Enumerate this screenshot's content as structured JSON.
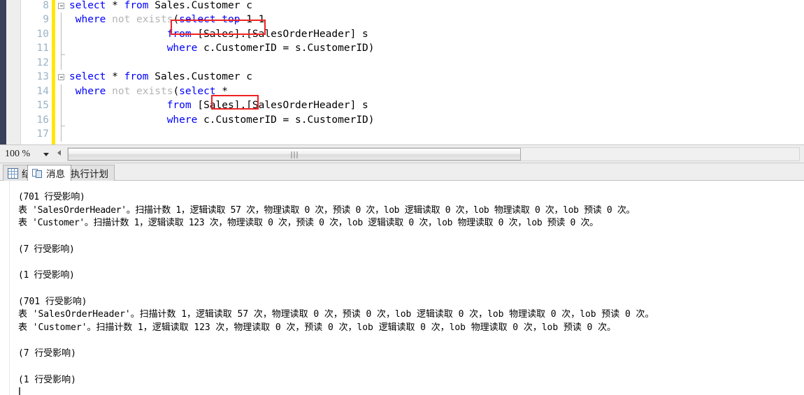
{
  "app": {
    "name": "SQL Server Management Studio",
    "pane_kind": "query-editor-with-messages"
  },
  "editor": {
    "gutter_change_color": "#ffe800",
    "selection_margin_color": "#394059",
    "keyword_color": "#0000ff",
    "comment_gray_color": "#b4b4b4",
    "lines": [
      {
        "number": "8",
        "outline": "collapse-box",
        "segments": [
          {
            "t": "select",
            "c": "kw"
          },
          {
            "t": " * ",
            "c": "blk"
          },
          {
            "t": "from",
            "c": "kw"
          },
          {
            "t": " Sales.Customer c",
            "c": "blk"
          }
        ]
      },
      {
        "number": "9",
        "outline": "vline",
        "segments": [
          {
            "t": " ",
            "c": "blk"
          },
          {
            "t": "where",
            "c": "kw"
          },
          {
            "t": " ",
            "c": "blk"
          },
          {
            "t": "not exists",
            "c": "gr"
          },
          {
            "t": "(",
            "c": "blk"
          },
          {
            "t": "select",
            "c": "kw"
          },
          {
            "t": " ",
            "c": "blk"
          },
          {
            "t": "top",
            "c": "kw"
          },
          {
            "t": " 1 1",
            "c": "blk"
          }
        ]
      },
      {
        "number": "10",
        "outline": "vline",
        "segments": [
          {
            "t": "                ",
            "c": "blk"
          },
          {
            "t": "from",
            "c": "kw"
          },
          {
            "t": " [Sales].[SalesOrderHeader] s",
            "c": "blk"
          }
        ]
      },
      {
        "number": "11",
        "outline": "vline-foot",
        "segments": [
          {
            "t": "                ",
            "c": "blk"
          },
          {
            "t": "where",
            "c": "kw"
          },
          {
            "t": " c.CustomerID = s.CustomerID)",
            "c": "blk"
          }
        ]
      },
      {
        "number": "12",
        "outline": "vline",
        "segments": [
          {
            "t": "",
            "c": "blk"
          }
        ]
      },
      {
        "number": "13",
        "outline": "collapse-box",
        "segments": [
          {
            "t": "select",
            "c": "kw"
          },
          {
            "t": " * ",
            "c": "blk"
          },
          {
            "t": "from",
            "c": "kw"
          },
          {
            "t": " Sales.Customer c",
            "c": "blk"
          }
        ]
      },
      {
        "number": "14",
        "outline": "vline",
        "segments": [
          {
            "t": " ",
            "c": "blk"
          },
          {
            "t": "where",
            "c": "kw"
          },
          {
            "t": " ",
            "c": "blk"
          },
          {
            "t": "not exists",
            "c": "gr"
          },
          {
            "t": "(",
            "c": "blk"
          },
          {
            "t": "select",
            "c": "kw"
          },
          {
            "t": " * ",
            "c": "blk"
          }
        ]
      },
      {
        "number": "15",
        "outline": "vline",
        "segments": [
          {
            "t": "                ",
            "c": "blk"
          },
          {
            "t": "from",
            "c": "kw"
          },
          {
            "t": " [Sales].[SalesOrderHeader] s",
            "c": "blk"
          }
        ]
      },
      {
        "number": "16",
        "outline": "vline-foot",
        "segments": [
          {
            "t": "                ",
            "c": "blk"
          },
          {
            "t": "where",
            "c": "kw"
          },
          {
            "t": " c.CustomerID = s.CustomerID)",
            "c": "blk"
          }
        ]
      },
      {
        "number": "17",
        "outline": "vline",
        "segments": [
          {
            "t": "",
            "c": "blk"
          }
        ]
      }
    ],
    "annotations": [
      {
        "label": "select top 1 1",
        "color": "#ee2222"
      },
      {
        "label": "*",
        "color": "#ee2222"
      }
    ]
  },
  "toolbar": {
    "zoom_value": "100 %",
    "zoom_caret_icon": "chevron-down-icon",
    "hscroll_left_icon": "arrow-left-icon"
  },
  "result_tabs": [
    {
      "label": "结果",
      "icon": "grid-icon",
      "active": false
    },
    {
      "label": "消息",
      "icon": "document-icon",
      "active": true
    },
    {
      "label": "执行计划",
      "icon": "execution-plan-icon",
      "active": false
    }
  ],
  "messages": {
    "lines": [
      {
        "text": "(701 行受影响)",
        "spacing": "tight"
      },
      {
        "text": "表 'SalesOrderHeader'。扫描计数 1，逻辑读取 57 次，物理读取 0 次，预读 0 次，lob 逻辑读取 0 次，lob 物理读取 0 次，lob 预读 0 次。",
        "spacing": "tight"
      },
      {
        "text": "表 'Customer'。扫描计数 1，逻辑读取 123 次，物理读取 0 次，预读 0 次，lob 逻辑读取 0 次，lob 物理读取 0 次，lob 预读 0 次。",
        "spacing": "tight"
      },
      {
        "text": "",
        "spacing": "tight"
      },
      {
        "text": "(7 行受影响)",
        "spacing": "tight"
      },
      {
        "text": "",
        "spacing": "tight"
      },
      {
        "text": "(1 行受影响)",
        "spacing": "tight"
      },
      {
        "text": "",
        "spacing": "tight"
      },
      {
        "text": "(701 行受影响)",
        "spacing": "wide"
      },
      {
        "text": "表 'SalesOrderHeader'。扫描计数 1，逻辑读取 57 次，物理读取 0 次，预读 0 次，lob 逻辑读取 0 次，lob 物理读取 0 次，lob 预读 0 次。",
        "spacing": "wide"
      },
      {
        "text": "表 'Customer'。扫描计数 1，逻辑读取 123 次，物理读取 0 次，预读 0 次，lob 逻辑读取 0 次，lob 物理读取 0 次，lob 预读 0 次。",
        "spacing": "wide"
      },
      {
        "text": "",
        "spacing": "wide"
      },
      {
        "text": "(7 行受影响)",
        "spacing": "wide"
      },
      {
        "text": "",
        "spacing": "wide"
      },
      {
        "text": "(1 行受影响)",
        "spacing": "wide"
      }
    ]
  }
}
